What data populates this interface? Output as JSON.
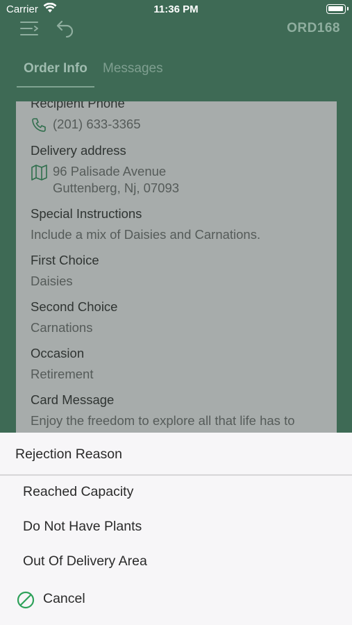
{
  "status_bar": {
    "carrier": "Carrier",
    "time": "11:36 PM"
  },
  "header": {
    "order_id": "ORD168",
    "menu_icon": "menu-icon",
    "back_icon": "undo-arrow-icon"
  },
  "tabs": [
    {
      "label": "Order Info",
      "active": true
    },
    {
      "label": "Messages",
      "active": false
    }
  ],
  "order": {
    "recipient_phone_label": "Recipient Phone",
    "recipient_phone": "(201) 633-3365",
    "delivery_address_label": "Delivery address",
    "address_line1": "96 Palisade Avenue",
    "address_line2": "Guttenberg, Nj, 07093",
    "special_instructions_label": "Special Instructions",
    "special_instructions": "Include a mix of Daisies and Carnations.",
    "first_choice_label": "First Choice",
    "first_choice": "Daisies",
    "second_choice_label": "Second Choice",
    "second_choice": "Carnations",
    "occasion_label": "Occasion",
    "occasion": "Retirement",
    "card_message_label": "Card Message",
    "card_message": "Enjoy the freedom to explore all that life has to"
  },
  "rejection_sheet": {
    "title": "Rejection Reason",
    "options": [
      "Reached Capacity",
      "Do Not Have Plants",
      "Out Of Delivery Area"
    ],
    "cancel_label": "Cancel"
  },
  "colors": {
    "header_bg": "#3e6a55",
    "card_bg": "#a7acab",
    "sheet_bg": "#f7f6f8",
    "accent_green": "#2ea15a"
  }
}
